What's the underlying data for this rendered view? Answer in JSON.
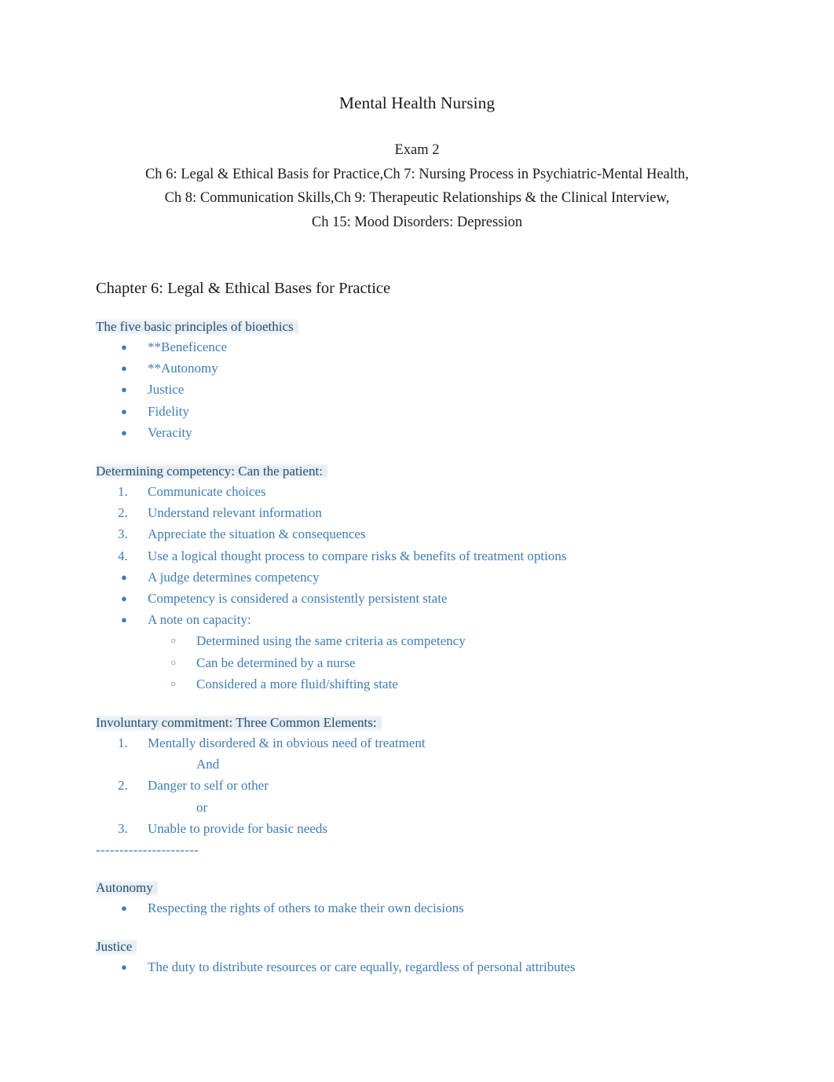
{
  "document": {
    "title": "Mental Health Nursing",
    "exam_label": "Exam 2",
    "chapter_lines": [
      "Ch 6: Legal & Ethical Basis for Practice,Ch 7: Nursing Process in Psychiatric-Mental Health,",
      "Ch 8: Communication Skills,Ch 9: Therapeutic Relationships & the Clinical Interview,",
      "Ch 15: Mood Disorders: Depression"
    ]
  },
  "colors": {
    "body_text": "#1a1a24",
    "subheading_blue": "#1f4e79",
    "list_blue": "#3f7cb5",
    "highlight_band": "#e6ecf0"
  },
  "chapter": {
    "heading": "Chapter 6: Legal & Ethical Bases for Practice"
  },
  "sections": {
    "bioethics": {
      "heading": "The five basic principles of bioethics",
      "items": [
        "**Beneficence",
        "**Autonomy",
        "Justice",
        "Fidelity",
        "Veracity"
      ]
    },
    "competency": {
      "heading": "Determining competency: Can the patient:",
      "numbered": [
        {
          "num": "1.",
          "text": "Communicate choices"
        },
        {
          "num": "2.",
          "text": "Understand relevant information"
        },
        {
          "num": "3.",
          "text": "Appreciate the situation & consequences"
        },
        {
          "num": "4.",
          "text": "Use a logical thought process to compare risks & benefits of treatment options"
        }
      ],
      "bullets": [
        "A judge determines competency",
        "Competency is considered a consistently persistent state",
        "A note on capacity:"
      ],
      "capacity_subbullets": [
        "Determined using the same criteria as competency",
        "Can be determined by a nurse",
        "Considered a more fluid/shifting state"
      ]
    },
    "commitment": {
      "heading": "Involuntary commitment: Three Common Elements:",
      "elements": [
        {
          "num": "1.",
          "text": "Mentally disordered & in obvious need of treatment"
        },
        {
          "num": "2.",
          "text": "Danger to self or other"
        },
        {
          "num": "3.",
          "text": "Unable to provide for basic needs"
        }
      ],
      "connector_1": "And",
      "connector_2": "or"
    },
    "divider": "----------------------",
    "autonomy": {
      "heading": "Autonomy",
      "items": [
        "Respecting the rights of others to make their own decisions"
      ]
    },
    "justice": {
      "heading": "Justice",
      "items": [
        "The duty to distribute resources or care equally, regardless of personal attributes"
      ]
    }
  },
  "markers": {
    "bullet": "●",
    "hollow_bullet": "○"
  }
}
